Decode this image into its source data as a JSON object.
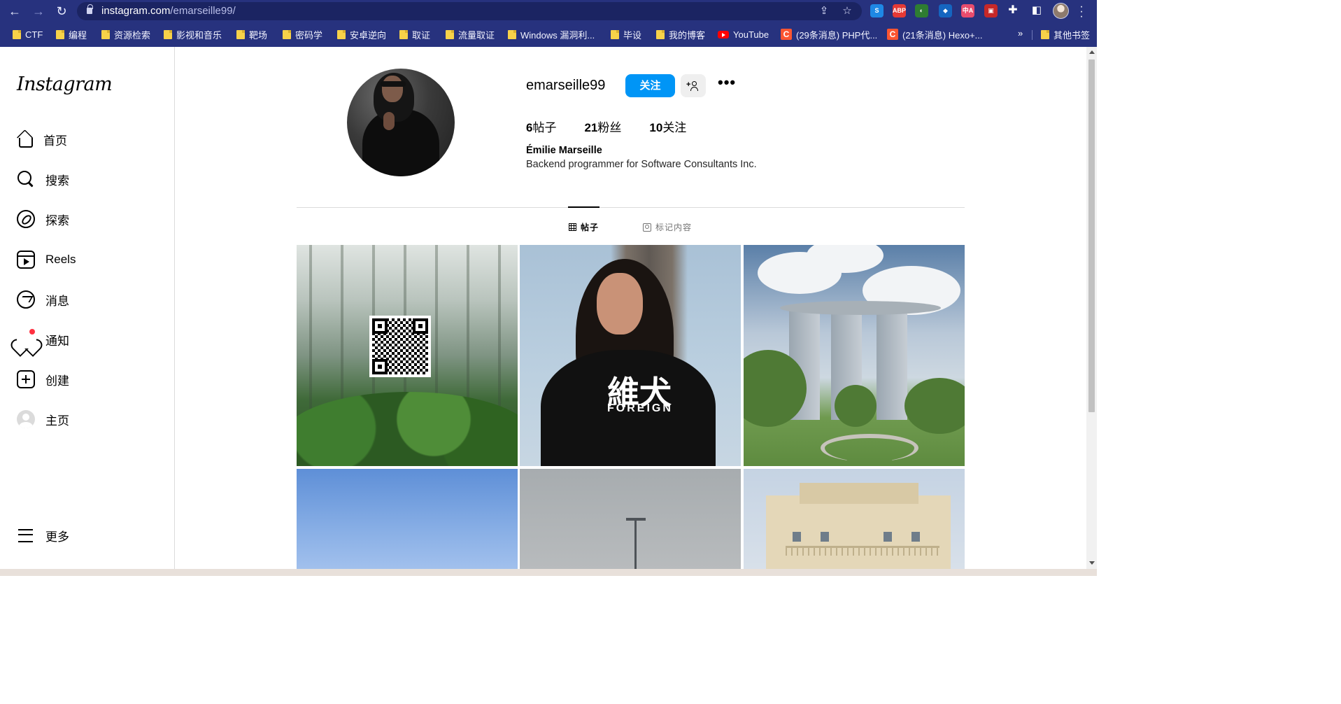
{
  "browser": {
    "url_domain": "instagram.com",
    "url_path": "/emarseille99/",
    "bookmarks": [
      {
        "label": "CTF",
        "icon": "folder-icon"
      },
      {
        "label": "编程",
        "icon": "folder-icon"
      },
      {
        "label": "资源检索",
        "icon": "folder-icon"
      },
      {
        "label": "影视和音乐",
        "icon": "folder-icon"
      },
      {
        "label": "靶场",
        "icon": "folder-icon"
      },
      {
        "label": "密码学",
        "icon": "folder-icon"
      },
      {
        "label": "安卓逆向",
        "icon": "folder-icon"
      },
      {
        "label": "取证",
        "icon": "folder-icon"
      },
      {
        "label": "流量取证",
        "icon": "folder-icon"
      },
      {
        "label": "Windows 漏洞利...",
        "icon": "folder-icon"
      },
      {
        "label": "毕设",
        "icon": "folder-icon"
      },
      {
        "label": "我的博客",
        "icon": "folder-icon"
      },
      {
        "label": "YouTube",
        "icon": "youtube-icon"
      },
      {
        "label": "(29条消息) PHP代...",
        "icon": "csdn-icon"
      },
      {
        "label": "(21条消息) Hexo+...",
        "icon": "csdn-icon"
      }
    ],
    "more_bookmarks_glyph": "»",
    "other_bookmarks": "其他书签",
    "extensions": [
      {
        "name": "s-extension-icon",
        "text": "S",
        "color": "#1e88e5"
      },
      {
        "name": "adblock-plus-icon",
        "text": "ABP",
        "color": "#e53935"
      },
      {
        "name": "ext-globe-icon",
        "text": "◐",
        "color": "#2e7d32"
      },
      {
        "name": "ext-diamond-icon",
        "text": "◆",
        "color": "#1565c0"
      },
      {
        "name": "ext-translate-icon",
        "text": "中A",
        "color": "#e84c6d"
      },
      {
        "name": "ext-red-icon",
        "text": "▣",
        "color": "#c62828"
      }
    ]
  },
  "sidebar": {
    "logo": "Instagram",
    "items": [
      {
        "label": "首页",
        "icon": "home-icon"
      },
      {
        "label": "搜索",
        "icon": "search-icon"
      },
      {
        "label": "探索",
        "icon": "explore-icon"
      },
      {
        "label": "Reels",
        "icon": "reels-icon"
      },
      {
        "label": "消息",
        "icon": "messenger-icon"
      },
      {
        "label": "通知",
        "icon": "heart-icon"
      },
      {
        "label": "创建",
        "icon": "create-icon"
      },
      {
        "label": "主页",
        "icon": "profile-avatar-icon"
      }
    ],
    "more_label": "更多"
  },
  "profile": {
    "username": "emarseille99",
    "follow_label": "关注",
    "options_glyph": "•••",
    "stats": [
      {
        "value": "6",
        "label": "帖子"
      },
      {
        "value": "21",
        "label": "粉丝"
      },
      {
        "value": "10",
        "label": "关注"
      }
    ],
    "full_name": "Émilie Marseille",
    "bio": "Backend programmer for Software Consultants Inc."
  },
  "tabs": [
    {
      "label": "帖子",
      "active": true
    },
    {
      "label": "标记内容",
      "active": false
    }
  ],
  "posts": {
    "p2_shirt_text": "維犬",
    "p2_shirt_subtext": "FOREIGN"
  },
  "colors": {
    "chrome_bg": "#27327e",
    "follow_button": "#0095f6",
    "notification_dot": "#ff3040"
  }
}
